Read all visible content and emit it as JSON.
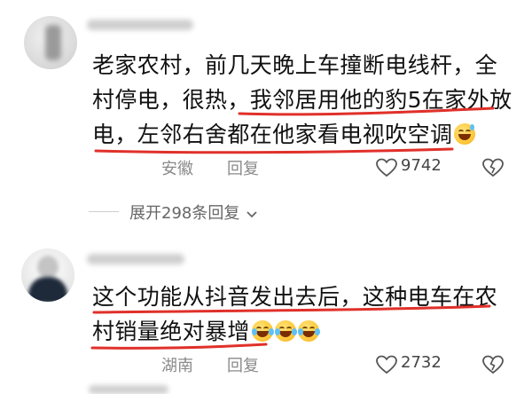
{
  "comments": [
    {
      "text_lines": [
        "老家农村，前几天晚上车撞断电线杆，全",
        "村停电，很热，我邻居用他的豹5在家外放",
        "电，左邻右舍都在他家看电视吹空调"
      ],
      "emoji": "grinning-sweat",
      "location": "安徽",
      "reply_label": "回复",
      "like_count": "9742",
      "expand_label": "展开298条回复"
    },
    {
      "text_lines": [
        "这个功能从抖音发出去后，这种电车在农",
        "村销量绝对暴增"
      ],
      "emoji": "tears-of-joy",
      "location": "湖南",
      "reply_label": "回复",
      "like_count": "2732"
    }
  ],
  "colors": {
    "underline": "#e0302a",
    "meta": "#8a8a8a",
    "text": "#111111"
  }
}
